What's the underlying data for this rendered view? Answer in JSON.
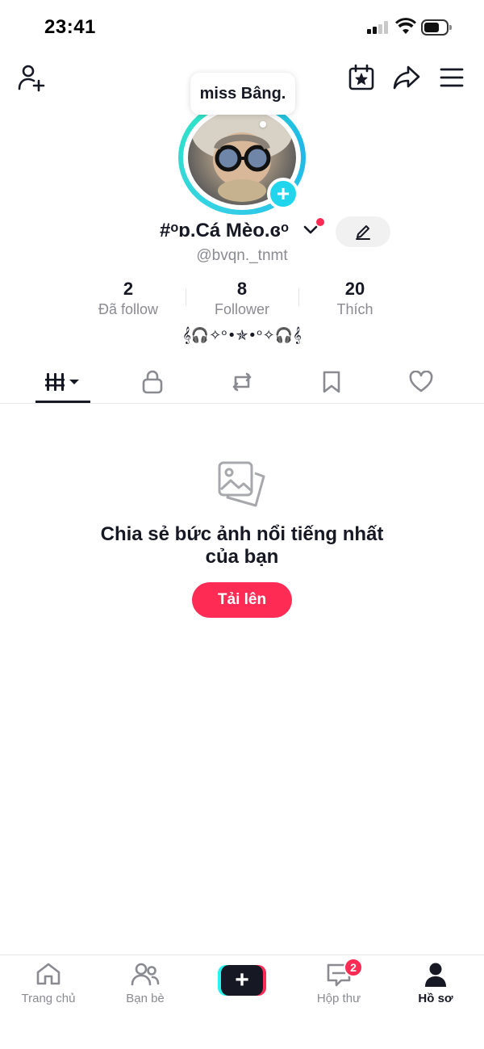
{
  "status_bar": {
    "time": "23:41"
  },
  "header": {
    "bubble_text": "miss Bâng."
  },
  "profile": {
    "display_name": "#ᵒɒ.Cá Mèo.ɞᵒ",
    "username": "@bvqn._tnmt",
    "bio": "𝄞🎧✧ᵒ•✯•ᵒ✧🎧𝄞"
  },
  "stats": [
    {
      "value": "2",
      "label": "Đã follow"
    },
    {
      "value": "8",
      "label": "Follower"
    },
    {
      "value": "20",
      "label": "Thích"
    }
  ],
  "tabs": [
    "videos-grid",
    "private",
    "reposts",
    "favorites",
    "liked"
  ],
  "empty_state": {
    "title_line1": "Chia sẻ bức ảnh nổi tiếng nhất",
    "title_line2": "của bạn",
    "button_label": "Tải lên"
  },
  "bottom_nav": {
    "home": "Trang chủ",
    "friends": "Bạn bè",
    "inbox": "Hộp thư",
    "inbox_badge": "2",
    "profile": "Hồ sơ"
  },
  "colors": {
    "accent_red": "#fe2c55",
    "accent_cyan": "#25f4ee",
    "avatar_ring": "#20d5ec",
    "text": "#161823",
    "muted": "#8a8b91"
  }
}
